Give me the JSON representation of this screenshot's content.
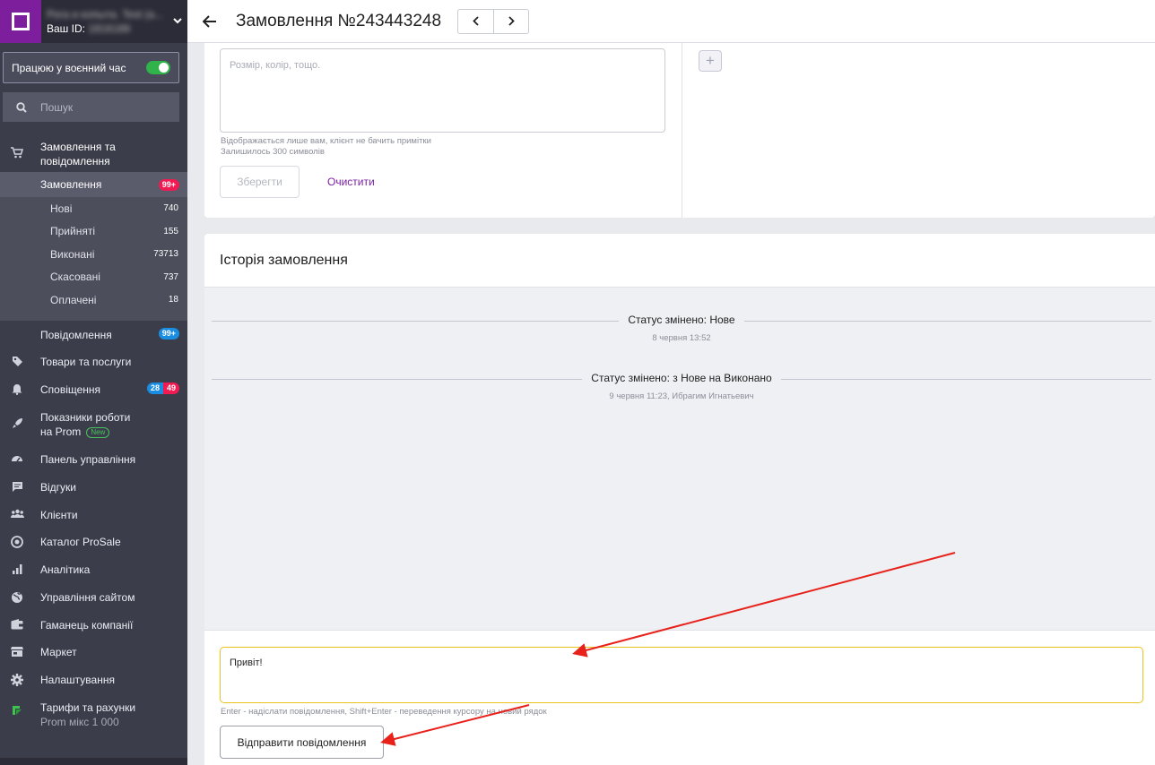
{
  "sidebar": {
    "account_name": "Рога и копыта. Test (a...",
    "account_id_label": "Ваш ID:",
    "account_id": "1816189",
    "wartime_label": "Працюю у воєнний час",
    "wartime_on": true,
    "search_placeholder": "Пошук",
    "orders_section": "Замовлення та повідомлення",
    "orders": {
      "label": "Замовлення",
      "badge": "99+"
    },
    "order_filters": [
      {
        "label": "Нові",
        "count": "740"
      },
      {
        "label": "Прийняті",
        "count": "155"
      },
      {
        "label": "Виконані",
        "count": "73713"
      },
      {
        "label": "Скасовані",
        "count": "737"
      },
      {
        "label": "Оплачені",
        "count": "18"
      }
    ],
    "messages": {
      "label": "Повідомлення",
      "badge": "99+"
    },
    "products": "Товари та послуги",
    "notifications": {
      "label": "Сповіщення",
      "badge_blue": "28",
      "badge_red": "49"
    },
    "performance": {
      "label_line1": "Показники роботи",
      "label_line2": "на Prom",
      "tag": "New"
    },
    "dashboard": "Панель управління",
    "reviews": "Відгуки",
    "clients": "Клієнти",
    "prosale": "Каталог ProSale",
    "analytics": "Аналітика",
    "site_management": "Управління сайтом",
    "wallet": "Гаманець компанії",
    "market": "Маркет",
    "settings": "Налаштування",
    "tariffs": {
      "label": "Тарифи та рахунки",
      "sub": "Prom мікс 1 000"
    }
  },
  "header": {
    "title": "Замовлення №243443248"
  },
  "notes": {
    "placeholder": "Розмір, колір, тощо.",
    "hint_line1": "Відображається лише вам, клієнт не бачить примітки",
    "hint_line2": "Залишилось 300 символів",
    "save_label": "Зберегти",
    "clear_label": "Очистити",
    "add_label": "+"
  },
  "history": {
    "title": "Історія замовлення",
    "events": [
      {
        "status": "Статус змінено: Нове",
        "when": "8 червня 13:52"
      },
      {
        "status": "Статус змінено: з Нове на Виконано",
        "when": "9 червня 11:23, Ибрагим Игнатьевич"
      }
    ],
    "message_value": "Привіт!",
    "message_hint": "Enter - надіслати повідомлення, Shift+Enter - переведення курсору на новий рядок",
    "send_label": "Відправити повідомлення"
  },
  "colors": {
    "brand": "#7d1e9c",
    "sidebar_bg": "#3b3d4a",
    "badge_red": "#ef1b52",
    "badge_blue": "#1a8de0",
    "toggle_on": "#2fb34a",
    "annotation_arrow": "#e8211a"
  }
}
